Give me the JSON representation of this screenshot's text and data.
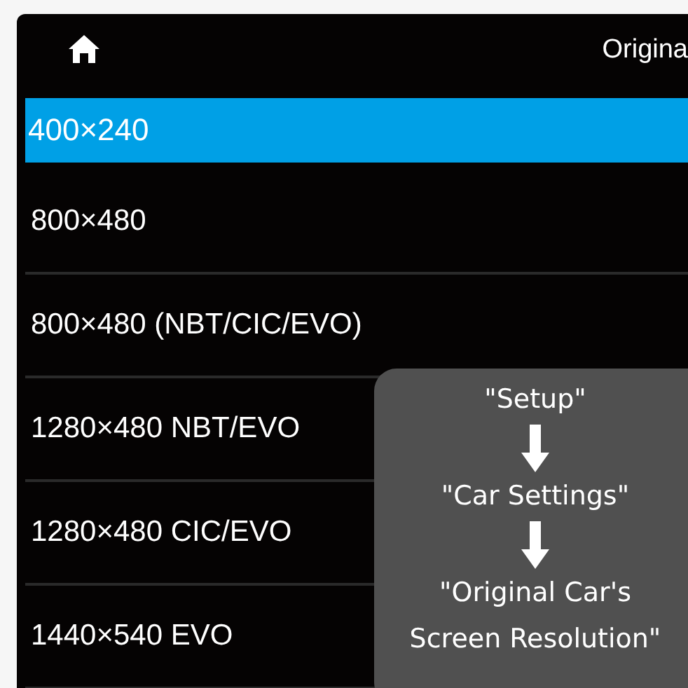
{
  "header": {
    "title": "Origina"
  },
  "options": [
    {
      "label": "400×240",
      "selected": true
    },
    {
      "label": "800×480",
      "selected": false
    },
    {
      "label": "800×480 (NBT/CIC/EVO)",
      "selected": false
    },
    {
      "label": "1280×480 NBT/EVO",
      "selected": false
    },
    {
      "label": "1280×480 CIC/EVO",
      "selected": false
    },
    {
      "label": "1440×540 EVO",
      "selected": false
    }
  ],
  "hint": {
    "steps": [
      "\"Setup\"",
      "\"Car Settings\"",
      "\"Original Car's Screen Resolution\""
    ]
  }
}
